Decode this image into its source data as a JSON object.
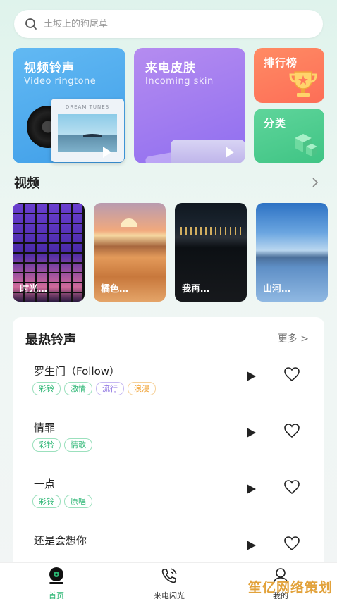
{
  "search": {
    "placeholder": "土坡上的狗尾草"
  },
  "cards": {
    "video": {
      "title": "视频铃声",
      "subtitle": "Video ringtone",
      "album_label": "DREAM TUNES"
    },
    "skin": {
      "title": "来电皮肤",
      "subtitle": "Incoming skin"
    },
    "rank": {
      "title": "排行榜"
    },
    "category": {
      "title": "分类"
    }
  },
  "videos_section": {
    "title": "视频",
    "more_icon": "chevron-right-icon",
    "items": [
      {
        "caption": "时光…"
      },
      {
        "caption": "橘色…"
      },
      {
        "caption": "我再…"
      },
      {
        "caption": "山河…"
      }
    ]
  },
  "hot": {
    "title": "最热铃声",
    "more": "更多 >",
    "rows": [
      {
        "name": "罗生门（Follow）",
        "tags": [
          "彩铃",
          "激情",
          "流行",
          "浪漫"
        ]
      },
      {
        "name": "情罪",
        "tags": [
          "彩铃",
          "情歌"
        ]
      },
      {
        "name": "一点",
        "tags": [
          "彩铃",
          "原唱"
        ]
      },
      {
        "name": "还是会想你",
        "tags": []
      }
    ]
  },
  "tag_colors": {
    "彩铃": "#2bb673",
    "激情": "#2bb673",
    "流行": "#8a6ee0",
    "浪漫": "#f0a030",
    "情歌": "#2bb673",
    "原唱": "#2bb673"
  },
  "nav": {
    "home": "首页",
    "flash": "来电闪光",
    "mine": "我的"
  },
  "watermark": "笙亿网络策划",
  "colors": {
    "accent": "#2bb673"
  }
}
